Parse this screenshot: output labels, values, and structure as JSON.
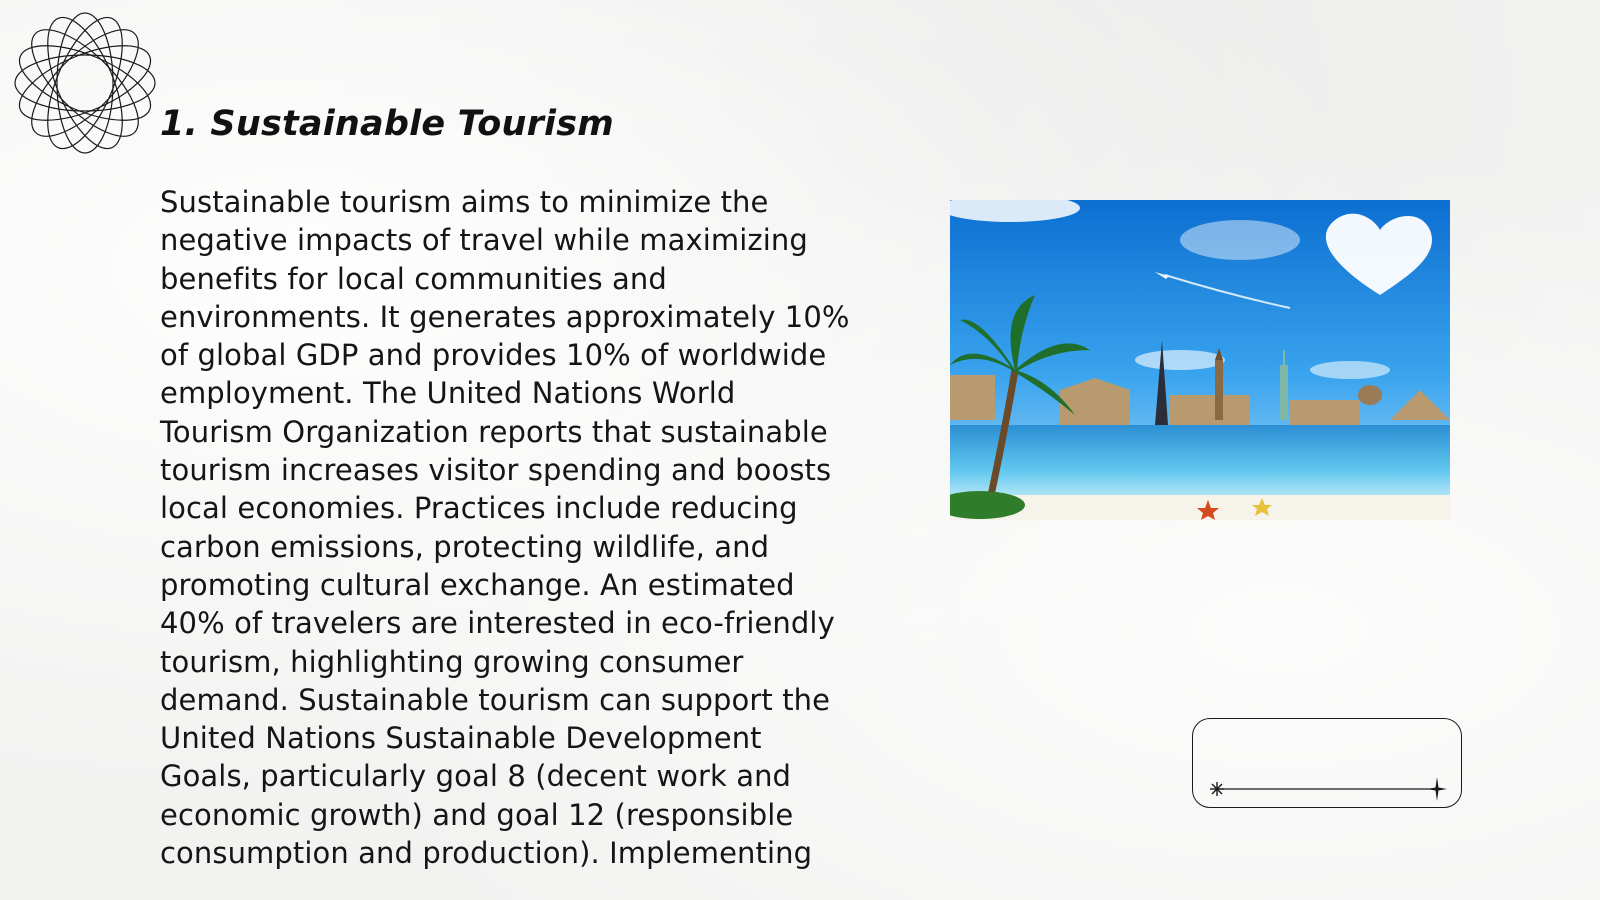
{
  "slide": {
    "title": "1. Sustainable Tourism",
    "body": "Sustainable tourism aims to minimize the negative impacts of travel while maximizing benefits for local communities and environments. It generates approximately 10% of global GDP and provides 10% of worldwide employment. The United Nations World Tourism Organization reports that sustainable tourism increases visitor spending and boosts local economies. Practices include reducing carbon emissions, protecting wildlife, and promoting cultural exchange. An estimated 40% of travelers are interested in eco-friendly tourism, highlighting growing consumer demand. Sustainable tourism can support the United Nations Sustainable Development Goals, particularly goal 8 (decent work and economic growth) and goal 12 (responsible consumption and production). Implementing"
  },
  "icons": {
    "logo": "orbit-rings-logo",
    "slider_start": "starburst-icon",
    "slider_end": "sparkle-icon"
  },
  "colors": {
    "background": "#f2f2f1",
    "text": "#151515",
    "sky": "#1a8fe0",
    "water": "#3fb3e8"
  }
}
